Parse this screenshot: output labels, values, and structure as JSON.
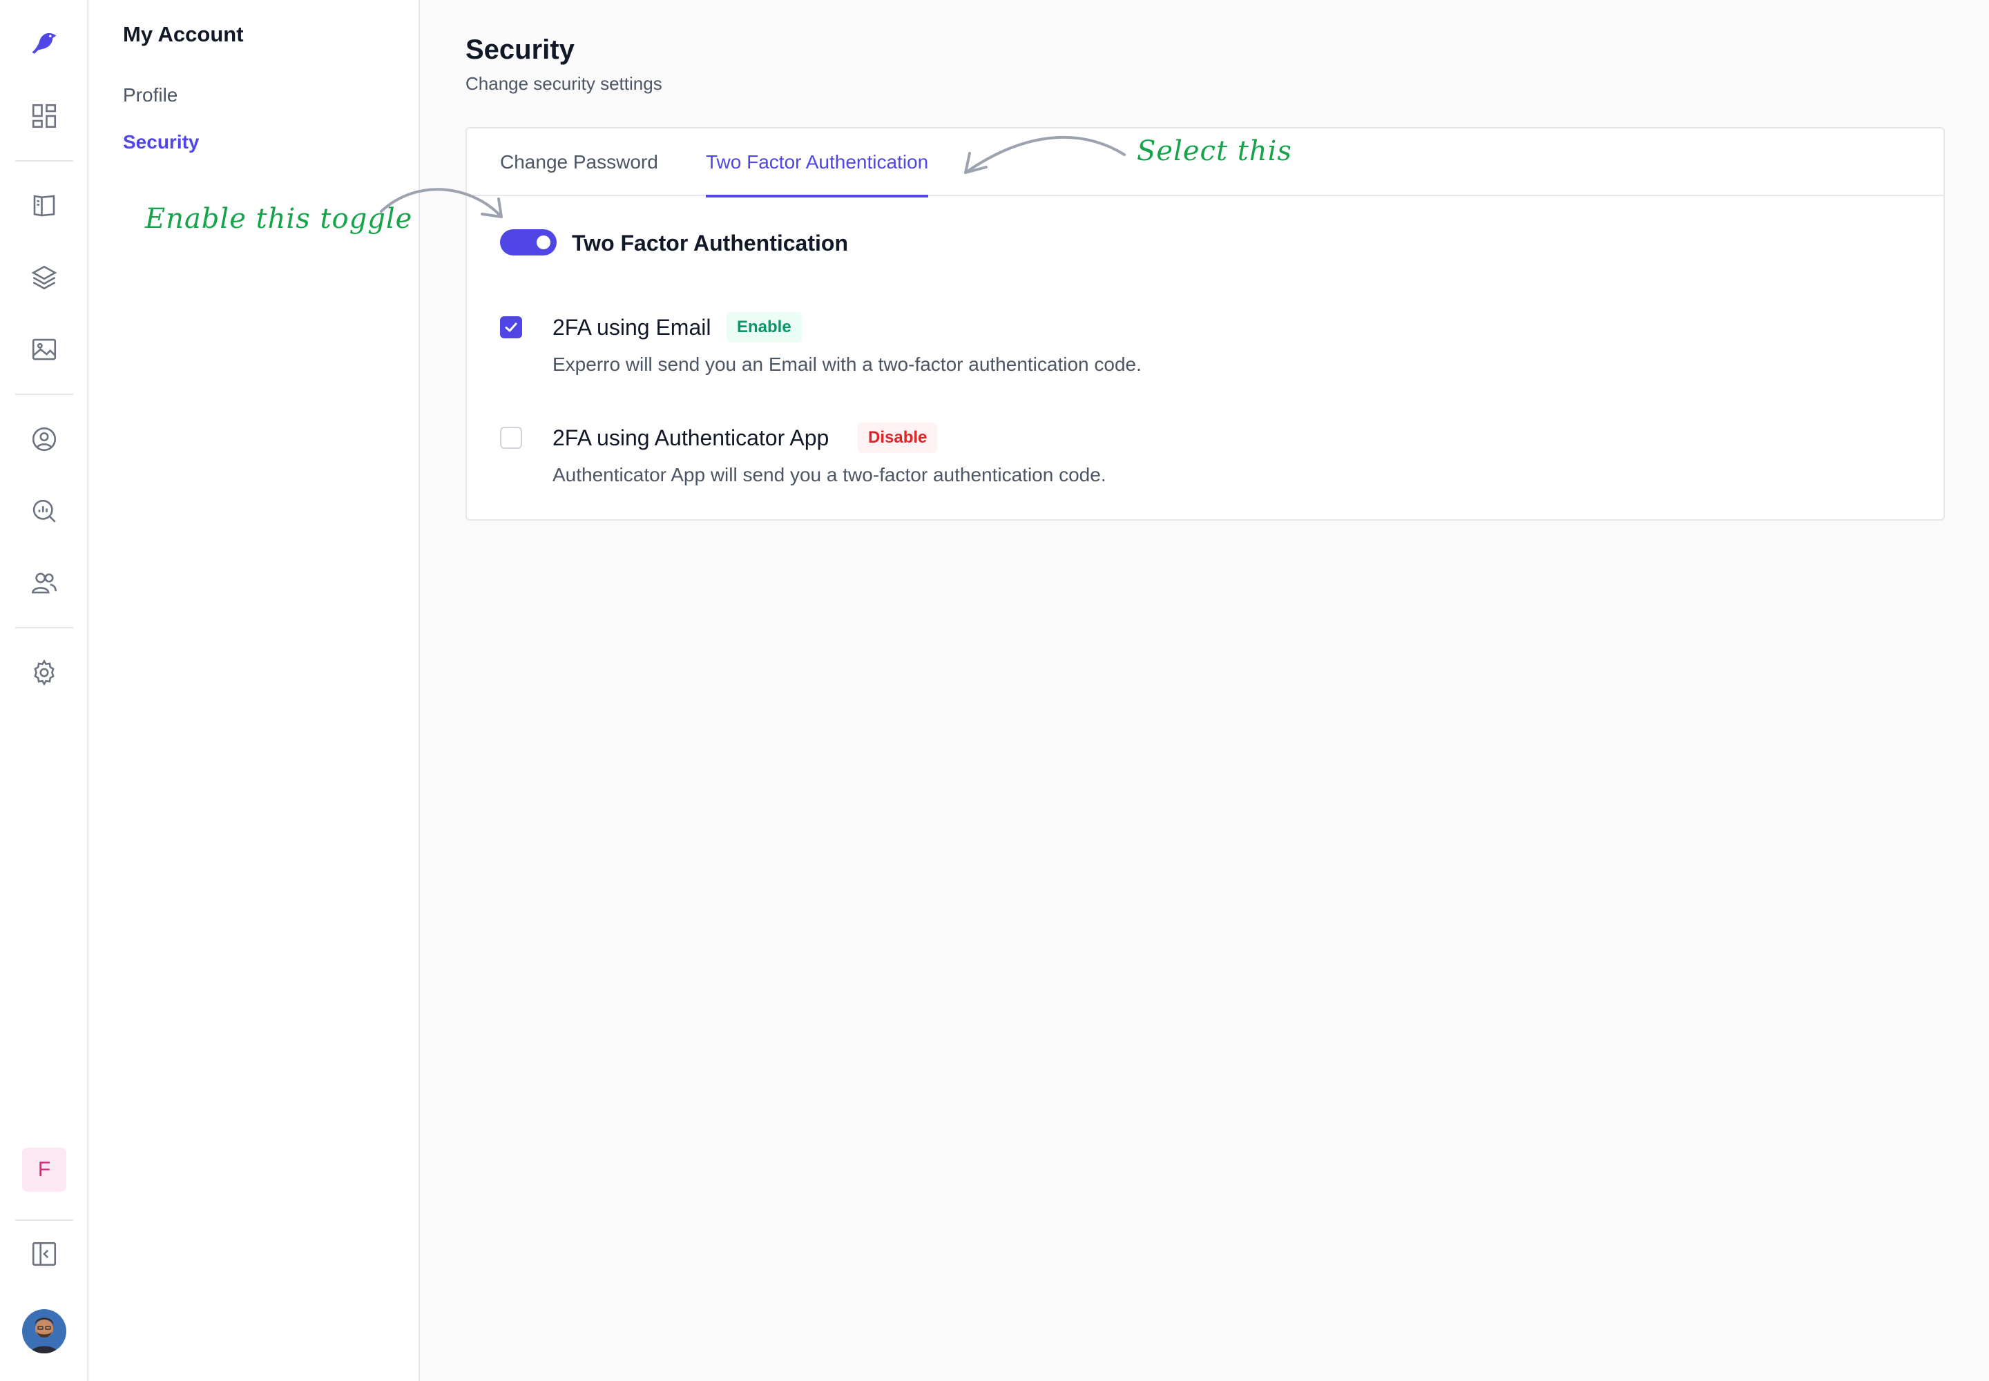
{
  "rail": {
    "icons": [
      "bird-logo-icon",
      "dashboard-grid-icon",
      "book-icon",
      "layers-icon",
      "image-icon",
      "user-circle-icon",
      "analytics-search-icon",
      "users-icon",
      "gear-icon",
      "collapse-sidebar-icon"
    ],
    "workspace_initial": "F"
  },
  "sidebar": {
    "title": "My Account",
    "items": [
      {
        "label": "Profile",
        "active": false
      },
      {
        "label": "Security",
        "active": true
      }
    ]
  },
  "header": {
    "title": "Security",
    "subtitle": "Change security settings"
  },
  "tabs": [
    {
      "label": "Change Password",
      "active": false
    },
    {
      "label": "Two Factor Authentication",
      "active": true
    }
  ],
  "two_factor": {
    "toggle_label": "Two Factor Authentication",
    "toggle_on": true,
    "options": [
      {
        "label": "2FA using Email",
        "checked": true,
        "badge": "Enable",
        "description": "Experro will send you an Email with a two-factor authentication code."
      },
      {
        "label": "2FA using Authenticator App",
        "checked": false,
        "badge": "Disable",
        "description": "Authenticator App will send you a two-factor authentication code."
      }
    ]
  },
  "annotations": {
    "select_tab": "Select this",
    "enable_toggle": "Enable this toggle"
  },
  "colors": {
    "accent": "#4f46e5",
    "enable_badge": "#059669",
    "disable_badge": "#dc2626",
    "annotation": "#16a34a",
    "workspace_badge": "#db2777"
  }
}
